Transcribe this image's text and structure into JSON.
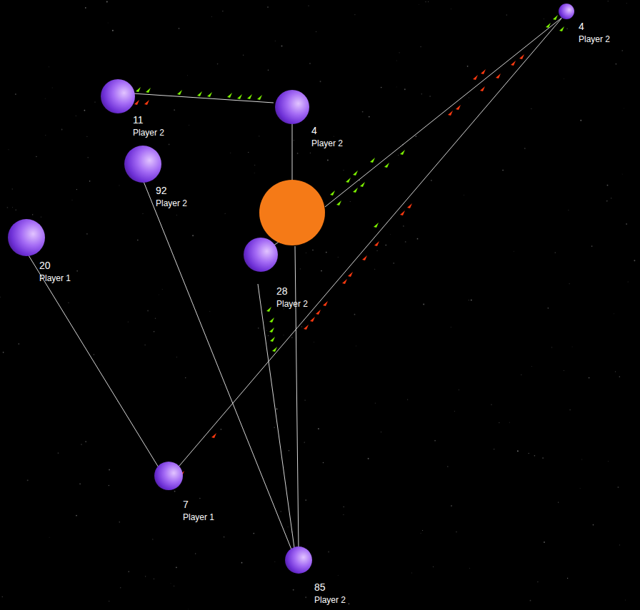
{
  "planets": [
    {
      "count": "4",
      "owner": "Player 2"
    },
    {
      "count": "11",
      "owner": "Player 2"
    },
    {
      "count": "4",
      "owner": "Player 2"
    },
    {
      "count": "92",
      "owner": "Player 2"
    },
    {
      "count": "20",
      "owner": "Player 1"
    },
    {
      "count": "28",
      "owner": "Player 2"
    },
    {
      "count": "7",
      "owner": "Player 1"
    },
    {
      "count": "85",
      "owner": "Player 2"
    }
  ],
  "fleets": [
    {
      "color": "#7cf000"
    },
    {
      "color": "#7cf000"
    },
    {
      "color": "#7cf000"
    },
    {
      "color": "#7cf000"
    },
    {
      "color": "#7cf000"
    },
    {
      "color": "#7cf000"
    },
    {
      "color": "#7cf000"
    },
    {
      "color": "#7cf000"
    },
    {
      "color": "#7cf000"
    },
    {
      "color": "#7cf000"
    },
    {
      "color": "#7cf000"
    },
    {
      "color": "#7cf000"
    },
    {
      "color": "#7cf000"
    },
    {
      "color": "#7cf000"
    },
    {
      "color": "#7cf000"
    },
    {
      "color": "#7cf000"
    },
    {
      "color": "#7cf000"
    },
    {
      "color": "#7cf000"
    },
    {
      "color": "#7cf000"
    },
    {
      "color": "#7cf000"
    },
    {
      "color": "#7cf000"
    },
    {
      "color": "#7cf000"
    },
    {
      "color": "#7cf000"
    },
    {
      "color": "#7cf000"
    },
    {
      "color": "#7cf000"
    },
    {
      "color": "#7cf000"
    },
    {
      "color": "#7cf000"
    },
    {
      "color": "#ff3a10"
    },
    {
      "color": "#ff3a10"
    },
    {
      "color": "#ff3a10"
    },
    {
      "color": "#ff3a10"
    },
    {
      "color": "#ff3a10"
    },
    {
      "color": "#ff3a10"
    },
    {
      "color": "#ff3a10"
    },
    {
      "color": "#ff3a10"
    },
    {
      "color": "#ff3a10"
    },
    {
      "color": "#ff3a10"
    },
    {
      "color": "#ff3a10"
    },
    {
      "color": "#ff3a10"
    },
    {
      "color": "#ff3a10"
    },
    {
      "color": "#ff3a10"
    },
    {
      "color": "#ff3a10"
    },
    {
      "color": "#ff3a10"
    },
    {
      "color": "#ff3a10"
    },
    {
      "color": "#ff3a10"
    },
    {
      "color": "#ff3a10"
    },
    {
      "color": "#ff3a10"
    },
    {
      "color": "#ff3a10"
    },
    {
      "color": "#ff3a10"
    }
  ]
}
